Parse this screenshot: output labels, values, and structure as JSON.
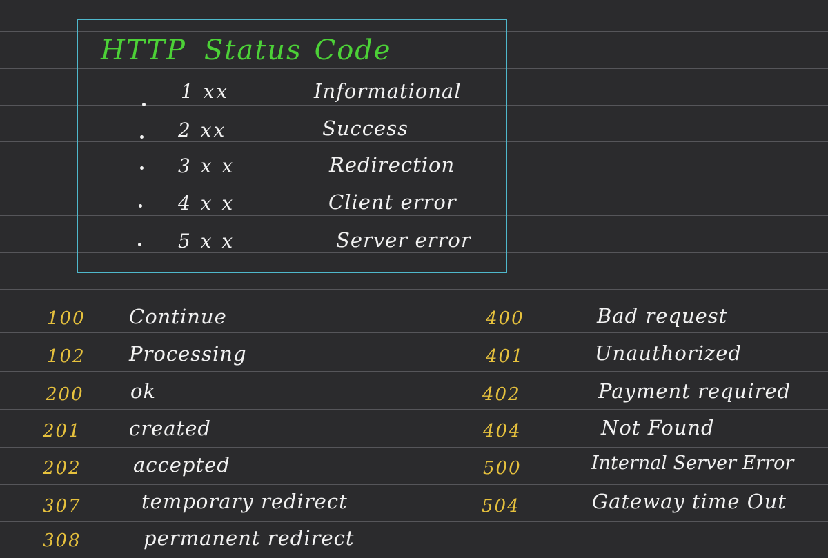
{
  "board": {
    "title_word1": "HTTP",
    "title_word2": "Status",
    "title_word3": "Code",
    "colors": {
      "background": "#2b2b2d",
      "lines": "#56565a",
      "frame": "#4fb8cc",
      "title": "#4cd137",
      "code": "#e6c13d",
      "text": "#f2f2f2"
    }
  },
  "classes": [
    {
      "code": "1 xx",
      "name": "Informational"
    },
    {
      "code": "2 xx",
      "name": "Success"
    },
    {
      "code": "3 x x",
      "name": "Redirection"
    },
    {
      "code": "4 x x",
      "name": "Client error"
    },
    {
      "code": "5 x x",
      "name": "Server error"
    }
  ],
  "left_codes": [
    {
      "code": "100",
      "text": "Continue"
    },
    {
      "code": "102",
      "text": "Processing"
    },
    {
      "code": "200",
      "text": "ok"
    },
    {
      "code": "201",
      "text": "created"
    },
    {
      "code": "202",
      "text": "accepted"
    },
    {
      "code": "307",
      "text": "temporary redirect"
    },
    {
      "code": "308",
      "text": "permanent redirect"
    }
  ],
  "right_codes": [
    {
      "code": "400",
      "text": "Bad request"
    },
    {
      "code": "401",
      "text": "Unauthorized"
    },
    {
      "code": "402",
      "text": "Payment required"
    },
    {
      "code": "404",
      "text": "Not Found"
    },
    {
      "code": "500",
      "text": "Internal Server Error"
    },
    {
      "code": "504",
      "text": "Gateway time Out"
    }
  ]
}
